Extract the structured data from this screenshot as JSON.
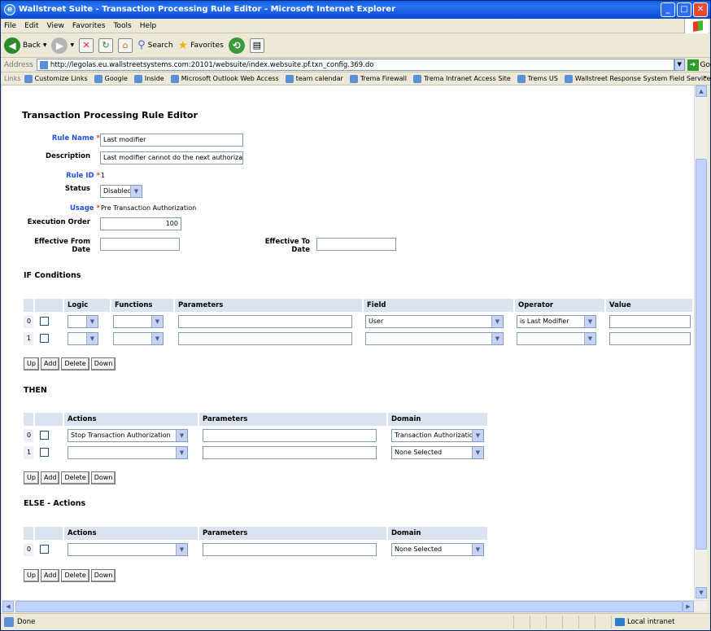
{
  "window": {
    "title": "Wallstreet Suite - Transaction Processing Rule Editor - Microsoft Internet Explorer"
  },
  "menu": [
    "File",
    "Edit",
    "View",
    "Favorites",
    "Tools",
    "Help"
  ],
  "toolbar": {
    "back": "Back",
    "search": "Search",
    "favorites": "Favorites"
  },
  "address": {
    "label": "Address",
    "url": "http://legolas.eu.wallstreetsystems.com:20101/websuite/index.websuite.pf.txn_config.369.do",
    "go": "Go"
  },
  "links": {
    "label": "Links",
    "items": [
      "Customize Links",
      "Google",
      "Inside",
      "Microsoft Outlook Web Access",
      "team calendar",
      "Trema Firewall",
      "Trema Intranet Access Site",
      "Trems US",
      "Wallstreet Response System Field Service"
    ],
    "more": "»"
  },
  "page": {
    "title": "Transaction Processing Rule Editor",
    "fields": {
      "rule_name": {
        "label": "Rule Name",
        "required": "*",
        "value": "Last modifier"
      },
      "description": {
        "label": "Description",
        "value": "Last modifier cannot do the next authorization"
      },
      "rule_id": {
        "label": "Rule ID",
        "required": "*",
        "value": "1"
      },
      "status": {
        "label": "Status",
        "value": "Disabled"
      },
      "usage": {
        "label": "Usage",
        "required": "*",
        "value": "Pre Transaction Authorization"
      },
      "execution_order": {
        "label": "Execution Order",
        "value": "100"
      },
      "effective_from": {
        "label": "Effective From Date",
        "value": ""
      },
      "effective_to": {
        "label": "Effective To Date",
        "value": ""
      }
    },
    "if_section": {
      "title": "IF Conditions",
      "headers": [
        "Logic",
        "Functions",
        "Parameters",
        "Field",
        "Operator",
        "Value"
      ],
      "rows": [
        {
          "num": "0",
          "logic": "",
          "function": "",
          "parameters": "",
          "field": "User",
          "operator": "is Last Modifier",
          "value": ""
        },
        {
          "num": "1",
          "logic": "",
          "function": "",
          "parameters": "",
          "field": "",
          "operator": "",
          "value": ""
        }
      ]
    },
    "then_section": {
      "title": "THEN",
      "headers": [
        "Actions",
        "Parameters",
        "Domain"
      ],
      "rows": [
        {
          "num": "0",
          "action": "Stop Transaction Authorization",
          "parameters": "",
          "domain": "Transaction Authorization"
        },
        {
          "num": "1",
          "action": "",
          "parameters": "",
          "domain": "None Selected"
        }
      ]
    },
    "else_section": {
      "title": "ELSE - Actions",
      "headers": [
        "Actions",
        "Parameters",
        "Domain"
      ],
      "rows": [
        {
          "num": "0",
          "action": "",
          "parameters": "",
          "domain": "None Selected"
        }
      ]
    },
    "buttons": {
      "up": "Up",
      "add": "Add",
      "delete": "Delete",
      "down": "Down"
    }
  },
  "status": {
    "text": "Done",
    "zone": "Local intranet"
  }
}
